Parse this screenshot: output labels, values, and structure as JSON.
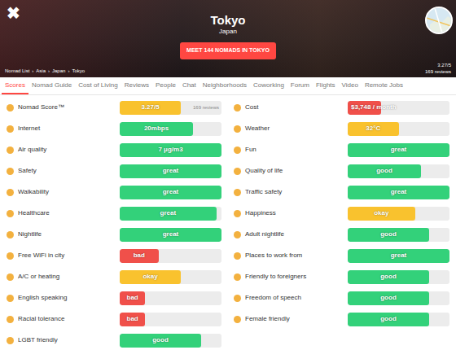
{
  "header": {
    "close": "✖",
    "city": "Tokyo",
    "country": "Japan",
    "meet_button": "MEET 144 NOMADS IN TOKYO",
    "breadcrumb": [
      "Nomad List",
      "Asia",
      "Japan",
      "Tokyo"
    ],
    "breadcrumb_sep": "›",
    "rating": "3.27/5",
    "reviews": "169 reviews"
  },
  "tabs": [
    {
      "label": "Scores",
      "selected": true
    },
    {
      "label": "Nomad Guide",
      "selected": false
    },
    {
      "label": "Cost of Living",
      "selected": false
    },
    {
      "label": "Reviews",
      "selected": false
    },
    {
      "label": "People",
      "selected": false
    },
    {
      "label": "Chat",
      "selected": false
    },
    {
      "label": "Neighborhoods",
      "selected": false
    },
    {
      "label": "Coworking",
      "selected": false
    },
    {
      "label": "Forum",
      "selected": false
    },
    {
      "label": "Flights",
      "selected": false
    },
    {
      "label": "Video",
      "selected": false
    },
    {
      "label": "Remote Jobs",
      "selected": false
    }
  ],
  "scores": {
    "left": [
      {
        "label": "Nomad Score™",
        "value": "3.27/5",
        "level": 0.6,
        "color": "#f9c22e",
        "note": "169 reviews"
      },
      {
        "label": "Internet",
        "value": "20mbps",
        "level": 0.72,
        "color": "#33d17a"
      },
      {
        "label": "Air quality",
        "value": "7 μg/m3",
        "level": 1,
        "color": "#33d17a"
      },
      {
        "label": "Safety",
        "value": "great",
        "level": 1,
        "color": "#33d17a"
      },
      {
        "label": "Walkability",
        "value": "great",
        "level": 1,
        "color": "#33d17a"
      },
      {
        "label": "Healthcare",
        "value": "great",
        "level": 0.95,
        "color": "#33d17a"
      },
      {
        "label": "Nightlife",
        "value": "great",
        "level": 1,
        "color": "#33d17a"
      },
      {
        "label": "Free WiFi in city",
        "value": "bad",
        "level": 0.38,
        "color": "#f0504a"
      },
      {
        "label": "A/C or heating",
        "value": "okay",
        "level": 0.6,
        "color": "#f9c22e"
      },
      {
        "label": "English speaking",
        "value": "bad",
        "level": 0.25,
        "color": "#f0504a"
      },
      {
        "label": "Racial tolerance",
        "value": "bad",
        "level": 0.25,
        "color": "#f0504a"
      },
      {
        "label": "LGBT friendly",
        "value": "good",
        "level": 0.8,
        "color": "#33d17a"
      }
    ],
    "right": [
      {
        "label": "Cost",
        "value": "$3,748 / month",
        "level": 0.33,
        "color": "#f0504a"
      },
      {
        "label": "Weather",
        "value": "32°C",
        "level": 0.5,
        "color": "#f9c22e"
      },
      {
        "label": "Fun",
        "value": "great",
        "level": 1,
        "color": "#33d17a"
      },
      {
        "label": "Quality of life",
        "value": "good",
        "level": 0.72,
        "color": "#33d17a"
      },
      {
        "label": "Traffic safety",
        "value": "great",
        "level": 1,
        "color": "#33d17a"
      },
      {
        "label": "Happiness",
        "value": "okay",
        "level": 0.66,
        "color": "#f9c22e"
      },
      {
        "label": "Adult nightlife",
        "value": "good",
        "level": 0.8,
        "color": "#33d17a"
      },
      {
        "label": "Places to work from",
        "value": "great",
        "level": 1,
        "color": "#33d17a"
      },
      {
        "label": "Friendly to foreigners",
        "value": "good",
        "level": 0.8,
        "color": "#33d17a"
      },
      {
        "label": "Freedom of speech",
        "value": "good",
        "level": 0.8,
        "color": "#33d17a"
      },
      {
        "label": "Female friendly",
        "value": "good",
        "level": 0.8,
        "color": "#33d17a"
      }
    ]
  }
}
